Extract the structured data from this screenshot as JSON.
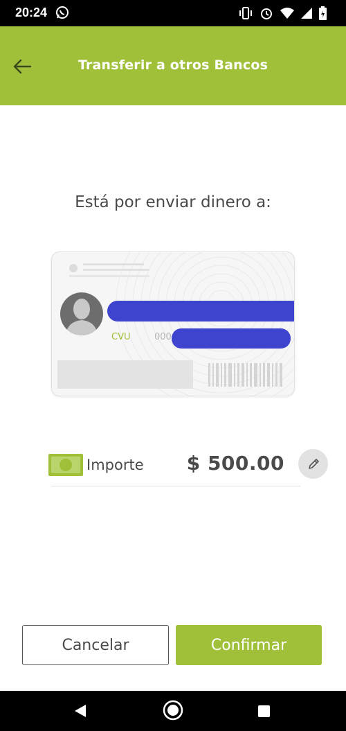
{
  "status_bar": {
    "time": "20:24",
    "icons": [
      "whatsapp-icon",
      "vibrate-icon",
      "alarm-icon",
      "wifi-icon",
      "signal-icon",
      "battery-icon"
    ]
  },
  "header": {
    "title": "Transferir a otros Bancos",
    "back_icon": "arrow-left-icon"
  },
  "main": {
    "send_label": "Está por enviar dinero a:",
    "card": {
      "account_type_label": "CVU",
      "account_number_prefix": "000"
    },
    "amount": {
      "label": "Importe",
      "value": "$ 500.00",
      "icon": "money-icon",
      "edit_icon": "pencil-icon"
    }
  },
  "actions": {
    "cancel_label": "Cancelar",
    "confirm_label": "Confirmar"
  },
  "nav_bar": {
    "icons": [
      "back-triangle-icon",
      "home-circle-icon",
      "recents-square-icon"
    ]
  },
  "colors": {
    "brand": "#a0c03a",
    "redaction": "#3f44cf",
    "text": "#4a4a4a"
  }
}
